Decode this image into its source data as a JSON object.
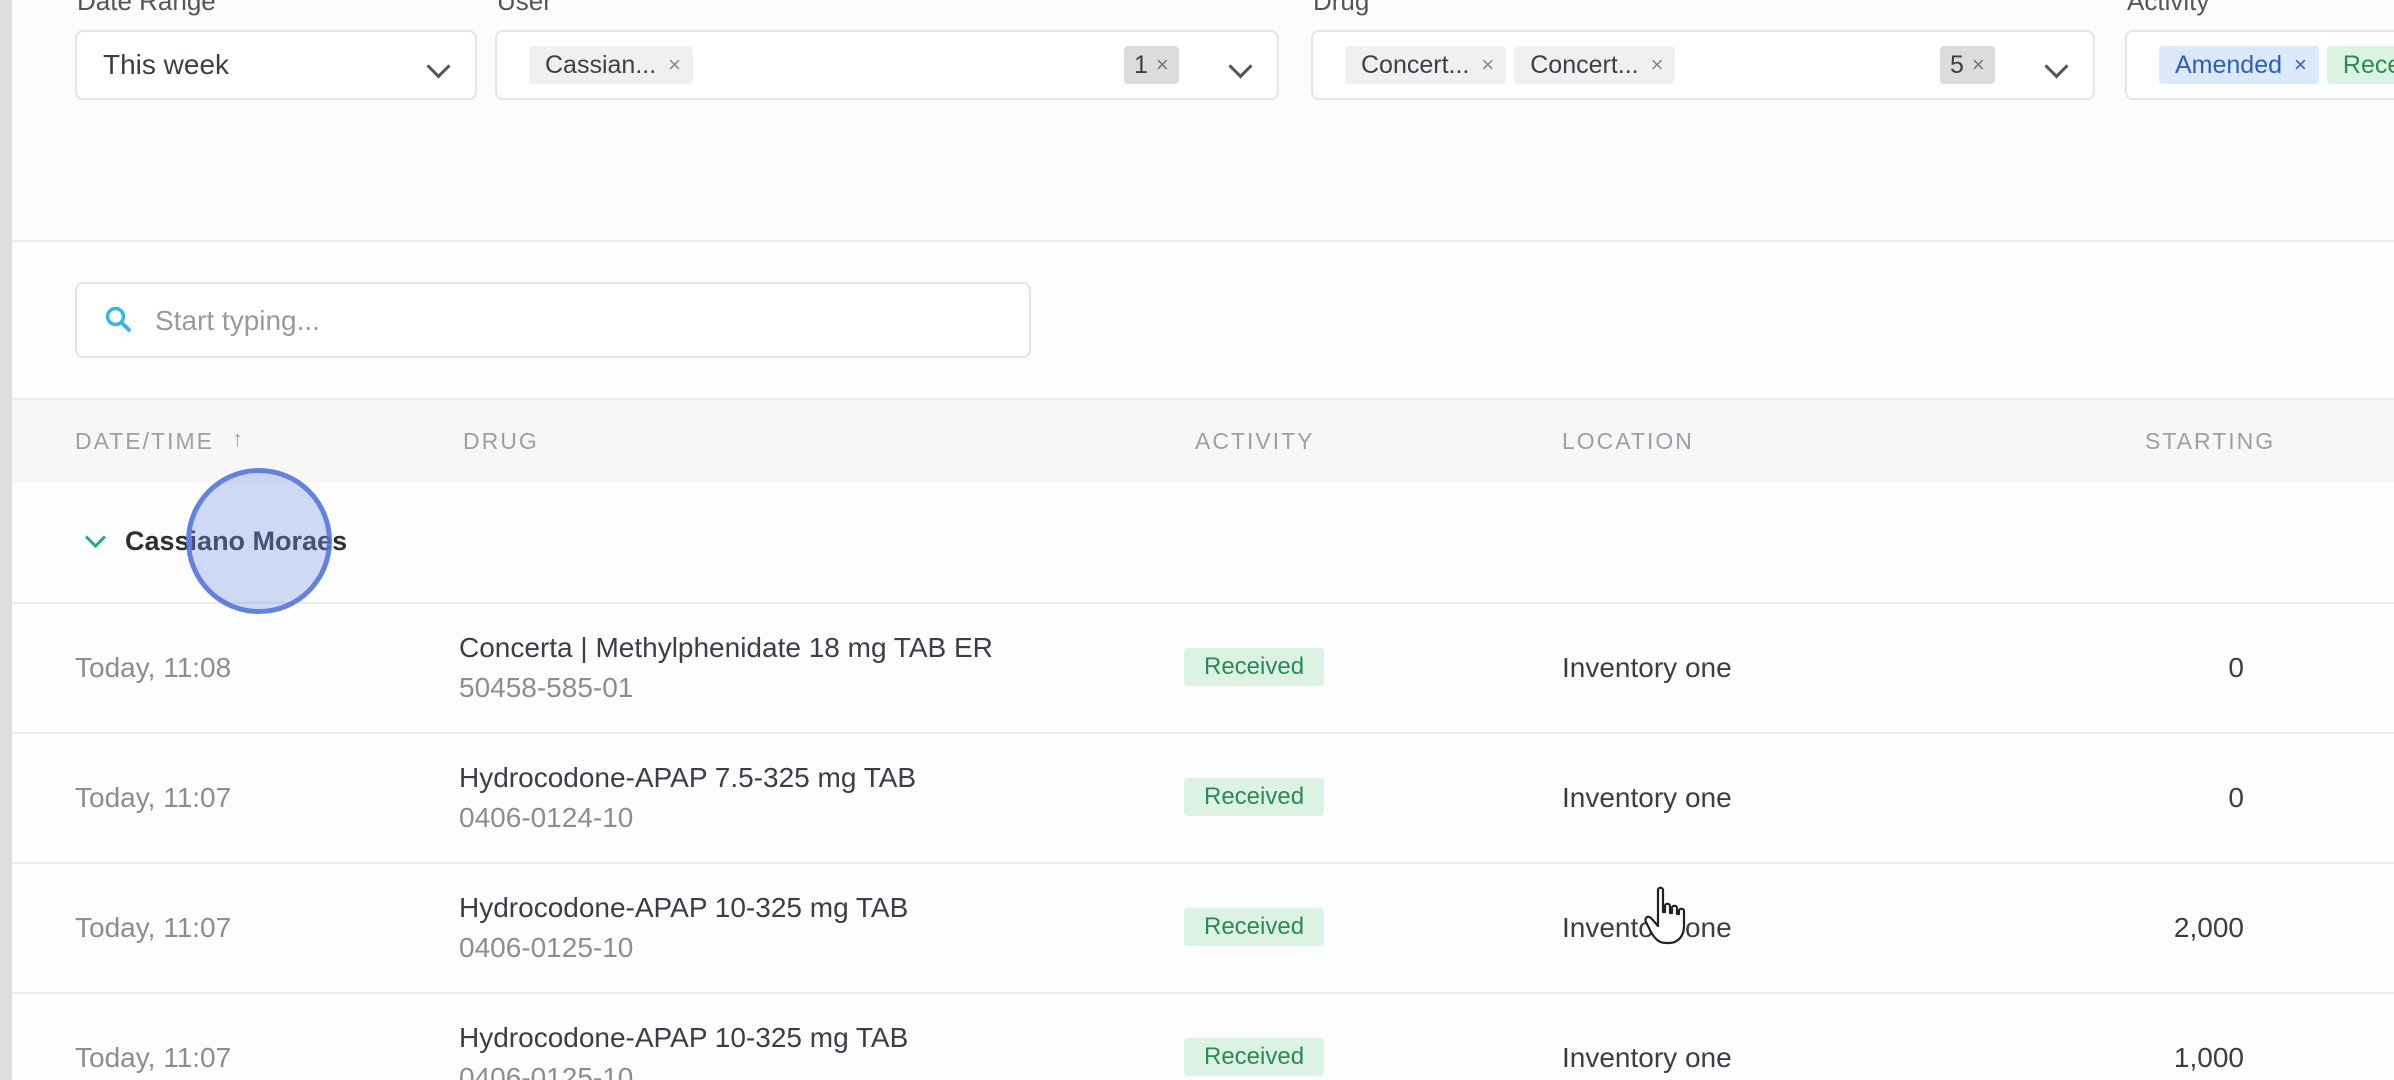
{
  "filters": {
    "date_range": {
      "label": "Date Range",
      "value": "This week"
    },
    "user": {
      "label": "User",
      "chips": [
        "Cassian..."
      ],
      "count": "1"
    },
    "drug": {
      "label": "Drug",
      "chips": [
        "Concert...",
        "Concert..."
      ],
      "count": "5"
    },
    "activity": {
      "label": "Activity",
      "chips": [
        "Amended",
        "Rece"
      ]
    }
  },
  "search": {
    "placeholder": "Start typing...",
    "value": ""
  },
  "table": {
    "columns": {
      "datetime": "DATE/TIME",
      "drug": "DRUG",
      "activity": "ACTIVITY",
      "location": "LOCATION",
      "starting": "STARTING"
    },
    "sort_indicator": "↑",
    "group": {
      "name": "Cassiano Moraes"
    },
    "rows": [
      {
        "datetime": "Today, 11:08",
        "drug": "Concerta | Methylphenidate 18 mg TAB ER",
        "ndc": "50458-585-01",
        "activity": "Received",
        "location": "Inventory one",
        "starting": "0"
      },
      {
        "datetime": "Today, 11:07",
        "drug": "Hydrocodone-APAP 7.5-325 mg TAB",
        "ndc": "0406-0124-10",
        "activity": "Received",
        "location": "Inventory one",
        "starting": "0"
      },
      {
        "datetime": "Today, 11:07",
        "drug": "Hydrocodone-APAP 10-325 mg TAB",
        "ndc": "0406-0125-10",
        "activity": "Received",
        "location": "Inventory one",
        "starting": "2,000"
      },
      {
        "datetime": "Today, 11:07",
        "drug": "Hydrocodone-APAP 10-325 mg TAB",
        "ndc": "0406-0125-10",
        "activity": "Received",
        "location": "Inventory one",
        "starting": "1,000"
      }
    ]
  },
  "icons": {
    "search": "search-icon",
    "sort": "sort-ascending-icon",
    "group_toggle": "chevron-down-icon",
    "remove_chip": "close-icon",
    "dropdown": "chevron-down-icon",
    "cursor": "hand-pointer-icon"
  },
  "colors": {
    "accent_teal": "#26a6a0",
    "received_badge_bg": "#dcf3e3",
    "received_badge_text": "#2c8a4f",
    "amended_chip_bg": "#dce8fb",
    "click_indicator": "#5073dc"
  }
}
